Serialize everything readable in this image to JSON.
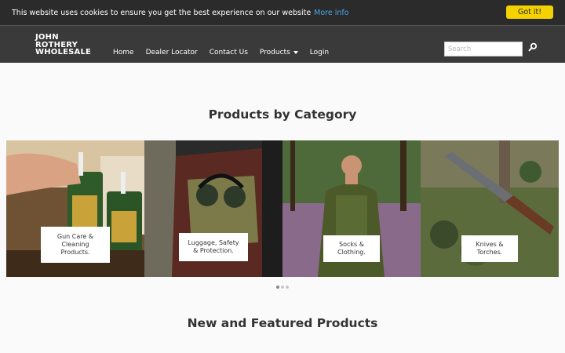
{
  "cookie": {
    "message": "This website uses cookies to ensure you get the best experience on our website",
    "more_info": "More info",
    "accept": "Got it!"
  },
  "brand": {
    "line1": "JOHN",
    "line2": "ROTHERY",
    "line3": "WHOLESALE"
  },
  "nav": {
    "home": "Home",
    "dealer_locator": "Dealer Locator",
    "contact_us": "Contact Us",
    "products": "Products",
    "login": "Login"
  },
  "search": {
    "placeholder": "Search"
  },
  "sections": {
    "products_by_category": "Products by Category",
    "new_featured": "New and Featured Products"
  },
  "categories": [
    {
      "label_line1": "Gun Care &",
      "label_line2": "Cleaning",
      "label_line3": "Products."
    },
    {
      "label_line1": "Luggage, Safety",
      "label_line2": "& Protection."
    },
    {
      "label_line1": "Socks &",
      "label_line2": "Clothing."
    },
    {
      "label_line1": "Knives &",
      "label_line2": "Torches."
    }
  ],
  "carousel": {
    "pages": 3,
    "active": 1
  },
  "colors": {
    "header_bg": "#3a3a3a",
    "cookie_bg": "#2b2b2b",
    "accent_button": "#f3d200",
    "link": "#4aa3e6"
  }
}
